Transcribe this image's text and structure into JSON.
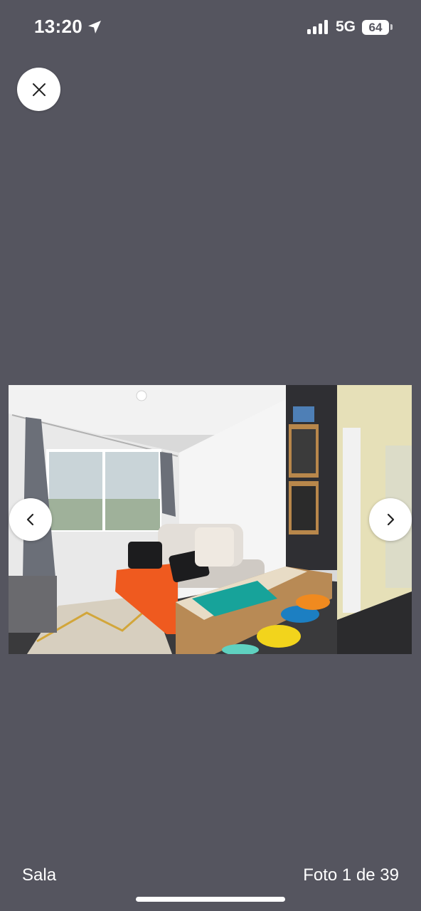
{
  "status_bar": {
    "time": "13:20",
    "network": "5G",
    "battery": "64"
  },
  "gallery": {
    "caption": "Sala",
    "counter": "Foto 1 de 39",
    "background_color": "#55555f"
  },
  "icons": {
    "close": "close-icon",
    "prev": "chevron-left-icon",
    "next": "chevron-right-icon",
    "location": "location-arrow-icon",
    "signal": "signal-bars-icon"
  }
}
